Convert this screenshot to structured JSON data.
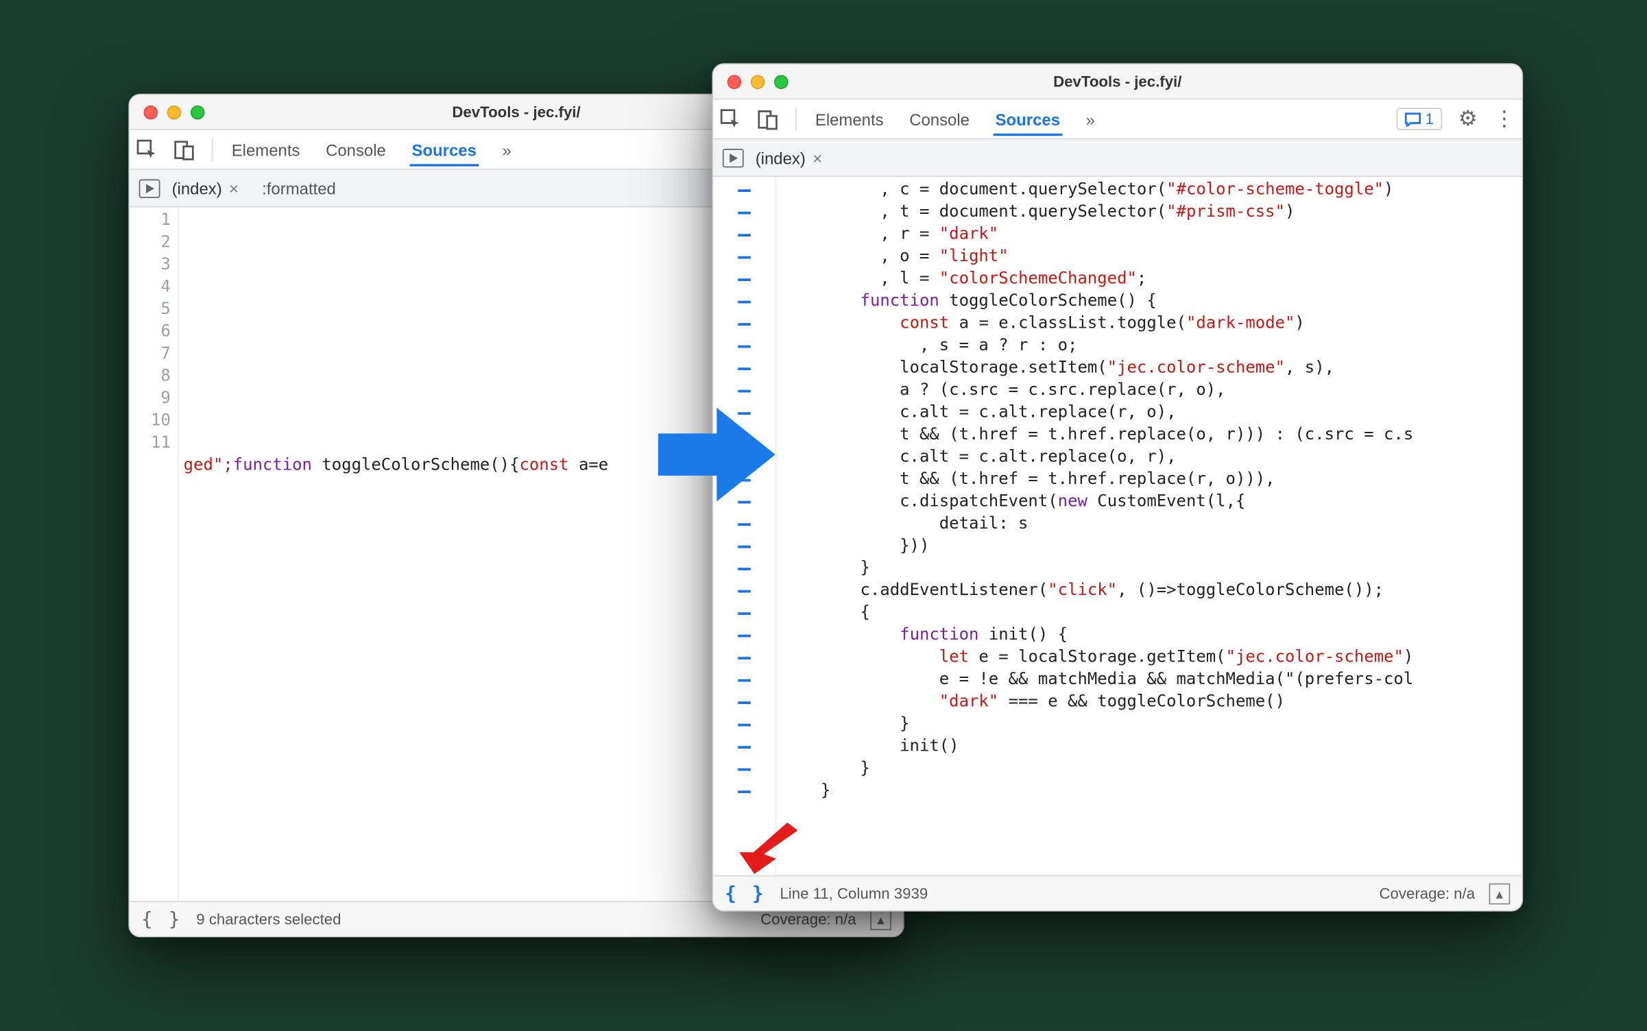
{
  "leftWindow": {
    "title": "DevTools - jec.fyi/",
    "tabs": {
      "elements": "Elements",
      "console": "Console",
      "sources": "Sources",
      "more": "»"
    },
    "fileTab": "(index)",
    "formattedLabel": ":formatted",
    "gutterLines": [
      "1",
      "2",
      "3",
      "4",
      "5",
      "6",
      "7",
      "8",
      "9",
      "10",
      "11"
    ],
    "codeLine11_pre": "ged\";",
    "codeLine11_kw": "function",
    "codeLine11_fn": " toggleColorScheme(){",
    "codeLine11_kw2": "const",
    "codeLine11_tail": " a=e",
    "footerStatus": "9 characters selected",
    "footerCoverage": "Coverage: n/a"
  },
  "rightWindow": {
    "title": "DevTools - jec.fyi/",
    "tabs": {
      "elements": "Elements",
      "console": "Console",
      "sources": "Sources",
      "more": "»"
    },
    "issueCount": "1",
    "fileTab": "(index)",
    "footerStatus": "Line 11, Column 3939",
    "footerCoverage": "Coverage: n/a",
    "code": {
      "l1": "          , c = document.querySelector(\"#color-scheme-toggle\")",
      "l2": "          , t = document.querySelector(\"#prism-css\")",
      "l3": "          , r = \"dark\"",
      "l4": "          , o = \"light\"",
      "l5": "          , l = \"colorSchemeChanged\";",
      "l6": "        function toggleColorScheme() {",
      "l7": "            const a = e.classList.toggle(\"dark-mode\")",
      "l8": "              , s = a ? r : o;",
      "l9": "            localStorage.setItem(\"jec.color-scheme\", s),",
      "l10": "            a ? (c.src = c.src.replace(r, o),",
      "l11": "            c.alt = c.alt.replace(r, o),",
      "l12": "            t && (t.href = t.href.replace(o, r))) : (c.src = c.s",
      "l13": "            c.alt = c.alt.replace(o, r),",
      "l14": "            t && (t.href = t.href.replace(r, o))),",
      "l15": "            c.dispatchEvent(new CustomEvent(l,{",
      "l16": "                detail: s",
      "l17": "            }))",
      "l18": "        }",
      "l19": "        c.addEventListener(\"click\", ()=>toggleColorScheme());",
      "l20": "        {",
      "l21": "            function init() {",
      "l22": "                let e = localStorage.getItem(\"jec.color-scheme\")",
      "l23": "                e = !e && matchMedia && matchMedia(\"(prefers-col",
      "l24": "                \"dark\" === e && toggleColorScheme()",
      "l25": "            }",
      "l26": "            init()",
      "l27": "        }",
      "l28": "    }"
    }
  }
}
